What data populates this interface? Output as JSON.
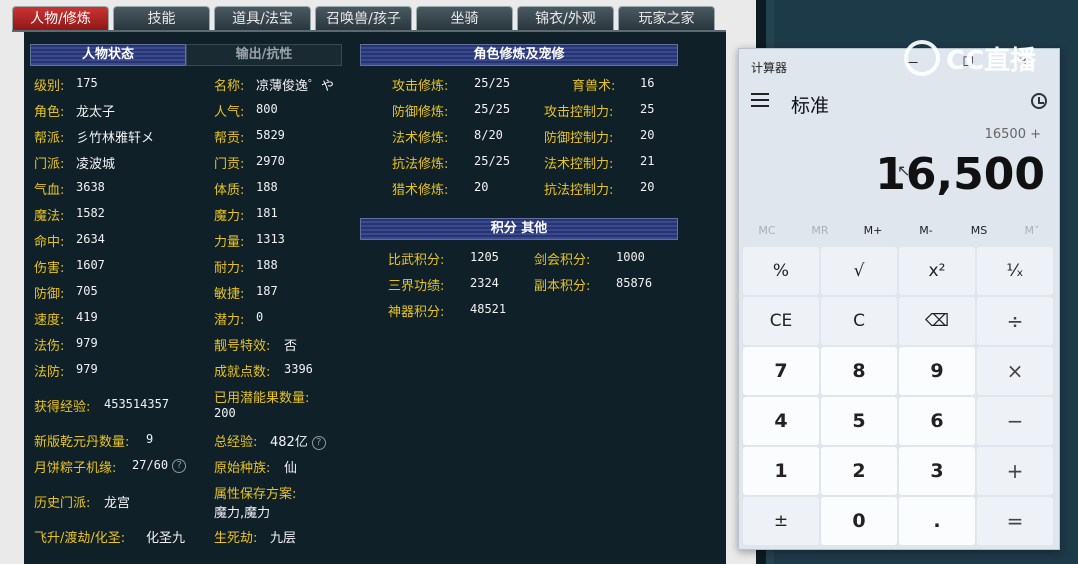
{
  "tabs": [
    "人物/修炼",
    "技能",
    "道具/法宝",
    "召唤兽/孩子",
    "坐骑",
    "锦衣/外观",
    "玩家之家"
  ],
  "headers": {
    "status": "人物状态",
    "output": "输出/抗性",
    "cultivation": "角色修炼及宠修",
    "points": "积分 其他"
  },
  "col1": [
    {
      "label": "级别:",
      "value": "175"
    },
    {
      "label": "角色:",
      "value": "龙太子"
    },
    {
      "label": "帮派:",
      "value": "彡竹林雅轩メ"
    },
    {
      "label": "门派:",
      "value": "凌波城"
    },
    {
      "label": "气血:",
      "value": "3638"
    },
    {
      "label": "魔法:",
      "value": "1582"
    },
    {
      "label": "命中:",
      "value": "2634"
    },
    {
      "label": "伤害:",
      "value": "1607"
    },
    {
      "label": "防御:",
      "value": "705"
    },
    {
      "label": "速度:",
      "value": "419"
    },
    {
      "label": "法伤:",
      "value": "979"
    },
    {
      "label": "法防:",
      "value": "979"
    }
  ],
  "col2": [
    {
      "label": "名称:",
      "value": "凉薄俊逸゜や"
    },
    {
      "label": "人气:",
      "value": "800"
    },
    {
      "label": "帮贡:",
      "value": "5829"
    },
    {
      "label": "门贡:",
      "value": "2970"
    },
    {
      "label": "体质:",
      "value": "188"
    },
    {
      "label": "魔力:",
      "value": "181"
    },
    {
      "label": "力量:",
      "value": "1313"
    },
    {
      "label": "耐力:",
      "value": "188"
    },
    {
      "label": "敏捷:",
      "value": "187"
    },
    {
      "label": "潜力:",
      "value": "0"
    },
    {
      "label": "靓号特效:",
      "value": "否"
    },
    {
      "label": "成就点数:",
      "value": "3396"
    }
  ],
  "extra_left": [
    {
      "label": "获得经验:",
      "value": "453514357"
    },
    {
      "label": "新版乾元丹数量:",
      "value": "9"
    },
    {
      "label": "月饼粽子机缘:",
      "value": "27/60"
    },
    {
      "label": "历史门派:",
      "value": "龙宫"
    },
    {
      "label": "飞升/渡劫/化圣:",
      "value": "化圣九"
    }
  ],
  "extra_right": [
    {
      "label": "已用潜能果数量:",
      "value": "200"
    },
    {
      "label": "总经验:",
      "value": "482亿"
    },
    {
      "label": "原始种族:",
      "value": "仙"
    },
    {
      "label": "属性保存方案:",
      "value": "魔力,魔力"
    },
    {
      "label": "生死劫:",
      "value": "九层"
    }
  ],
  "cult_left": [
    {
      "label": "攻击修炼:",
      "value": "25/25"
    },
    {
      "label": "防御修炼:",
      "value": "25/25"
    },
    {
      "label": "法术修炼:",
      "value": "8/20"
    },
    {
      "label": "抗法修炼:",
      "value": "25/25"
    },
    {
      "label": "猎术修炼:",
      "value": "20"
    }
  ],
  "cult_right": [
    {
      "label": "育兽术:",
      "value": "16"
    },
    {
      "label": "攻击控制力:",
      "value": "25"
    },
    {
      "label": "防御控制力:",
      "value": "20"
    },
    {
      "label": "法术控制力:",
      "value": "21"
    },
    {
      "label": "抗法控制力:",
      "value": "20"
    }
  ],
  "points_left": [
    {
      "label": "比武积分:",
      "value": "1205"
    },
    {
      "label": "三界功绩:",
      "value": "2324"
    },
    {
      "label": "神器积分:",
      "value": "48521"
    }
  ],
  "points_right": [
    {
      "label": "剑会积分:",
      "value": "1000"
    },
    {
      "label": "副本积分:",
      "value": "85876"
    }
  ],
  "help_glyph": "?",
  "watermark": "CC直播",
  "calc": {
    "title": "计算器",
    "window_controls": "— ☐ ✕",
    "mode": "标准",
    "expression": "16500 +",
    "display": "16,500",
    "memory": [
      "MC",
      "MR",
      "M+",
      "M-",
      "MS",
      "M˅"
    ],
    "keys": [
      [
        "%",
        "√",
        "x²",
        "¹⁄ₓ"
      ],
      [
        "CE",
        "C",
        "⌫",
        "÷"
      ],
      [
        "7",
        "8",
        "9",
        "×"
      ],
      [
        "4",
        "5",
        "6",
        "−"
      ],
      [
        "1",
        "2",
        "3",
        "+"
      ],
      [
        "±",
        "0",
        ".",
        "="
      ]
    ]
  },
  "cursor": "↖"
}
